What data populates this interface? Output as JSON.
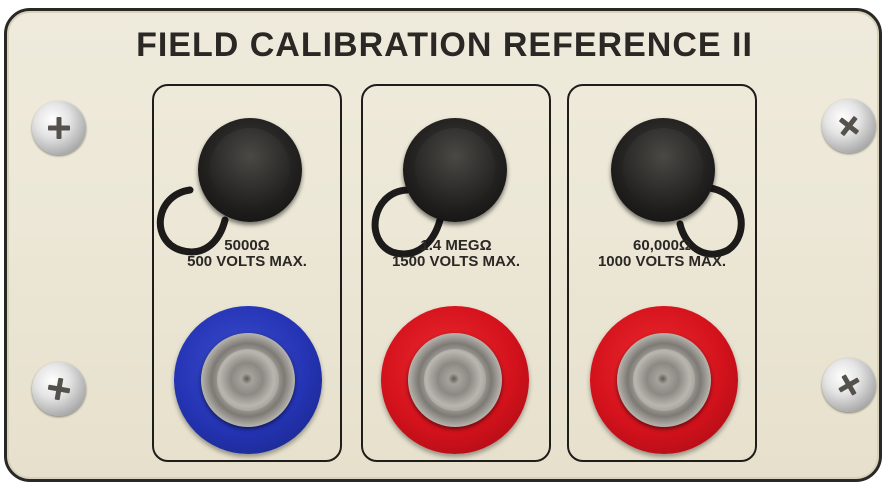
{
  "panel": {
    "title": "FIELD CALIBRATION REFERENCE II"
  },
  "bays": [
    {
      "resistance": "5000Ω",
      "max_voltage": "500 VOLTS MAX.",
      "post_color": "#1f2fa8",
      "post_color_name": "blue"
    },
    {
      "resistance": "1.4 MEGΩ",
      "max_voltage": "1500 VOLTS MAX.",
      "post_color": "#d3121c",
      "post_color_name": "red"
    },
    {
      "resistance": "60,000Ω",
      "max_voltage": "1000 VOLTS MAX.",
      "post_color": "#d3121c",
      "post_color_name": "red"
    }
  ],
  "icons": {
    "screw": "phillips-screw-icon",
    "connector_cap": "connector-cap-icon",
    "binding_post": "binding-post-icon"
  }
}
